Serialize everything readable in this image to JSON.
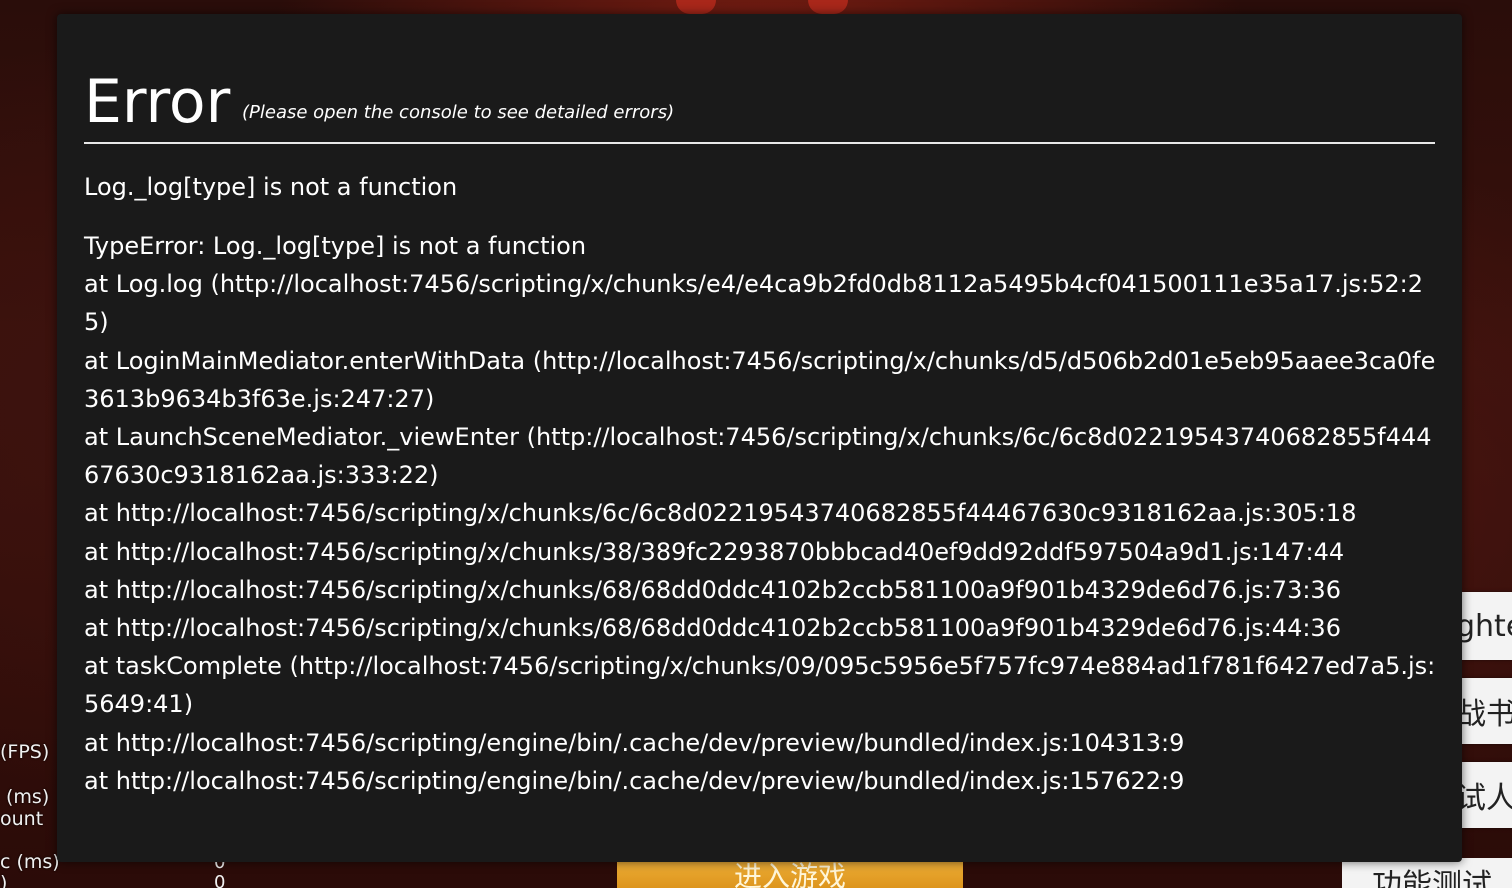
{
  "background": {
    "stats_labels": [
      "(FPS)",
      "(ms)",
      "ount",
      "c (ms)",
      ")"
    ],
    "stats_values": [
      "0",
      "0"
    ],
    "side_buttons": [
      "ghte",
      "战书",
      "试人"
    ],
    "bottom_button": "功能测试",
    "gold_button": "进入游戏"
  },
  "error": {
    "title": "Error",
    "hint": "(Please open the console to see detailed errors)",
    "message": "Log._log[type] is not a function",
    "stack": [
      "TypeError: Log._log[type] is not a function",
      "at Log.log (http://localhost:7456/scripting/x/chunks/e4/e4ca9b2fd0db8112a5495b4cf041500111e35a17.js:52:25)",
      "at LoginMainMediator.enterWithData (http://localhost:7456/scripting/x/chunks/d5/d506b2d01e5eb95aaee3ca0fe3613b9634b3f63e.js:247:27)",
      "at LaunchSceneMediator._viewEnter (http://localhost:7456/scripting/x/chunks/6c/6c8d02219543740682855f44467630c9318162aa.js:333:22)",
      "at http://localhost:7456/scripting/x/chunks/6c/6c8d02219543740682855f44467630c9318162aa.js:305:18",
      "at http://localhost:7456/scripting/x/chunks/38/389fc2293870bbbcad40ef9dd92ddf597504a9d1.js:147:44",
      "at http://localhost:7456/scripting/x/chunks/68/68dd0ddc4102b2ccb581100a9f901b4329de6d76.js:73:36",
      "at http://localhost:7456/scripting/x/chunks/68/68dd0ddc4102b2ccb581100a9f901b4329de6d76.js:44:36",
      "at taskComplete (http://localhost:7456/scripting/x/chunks/09/095c5956e5f757fc974e884ad1f781f6427ed7a5.js:5649:41)",
      "at http://localhost:7456/scripting/engine/bin/.cache/dev/preview/bundled/index.js:104313:9",
      "at http://localhost:7456/scripting/engine/bin/.cache/dev/preview/bundled/index.js:157622:9"
    ]
  }
}
